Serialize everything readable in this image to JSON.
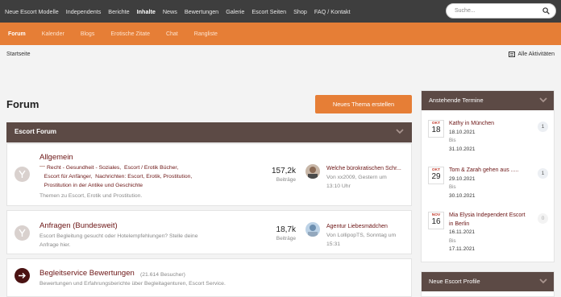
{
  "topnav": {
    "items": [
      "Neue Escort Modelle",
      "Independents",
      "Berichte",
      "Inhalte",
      "News",
      "Bewertungen",
      "Galerie",
      "Escort Seiten",
      "Shop",
      "FAQ / Kontakt"
    ],
    "active": "Inhalte",
    "search_placeholder": "Suche..."
  },
  "subnav": {
    "items": [
      "Forum",
      "Kalender",
      "Blogs",
      "Erotische Zitate",
      "Chat",
      "Rangliste"
    ],
    "active": "Forum"
  },
  "breadcrumb": "Startseite",
  "activity_label": "Alle Aktivitäten",
  "page_title": "Forum",
  "new_thread_label": "Neues Thema erstellen",
  "category": {
    "title": "Escort Forum"
  },
  "nodes": [
    {
      "title": "Allgemein",
      "subforums": [
        "Recht - Gesundheit - Soziales,",
        "Escort / Erotik Bücher,",
        "Escort für Anfänger,",
        "Nachrichten: Escort, Erotik, Prostitution,",
        "Prostitution in der Antike und Geschichte"
      ],
      "description": "Themen zu Escort, Erotik und Prostitution.",
      "count": "157,2k",
      "count_label": "Beiträge",
      "last_title": "Welche bürokratischen Schr...",
      "last_meta_1": "Von xx2009, Gestern um",
      "last_meta_2": "13:10 Uhr"
    },
    {
      "title": "Anfragen (Bundesweit)",
      "description_1": "Escort Begleitung gesucht oder Hotelempfehlungen? Stelle deine",
      "description_2": "Anfrage hier.",
      "count": "18,7k",
      "count_label": "Beiträge",
      "last_title": "Agentur Liebesmädchen",
      "last_meta_1": "Von LollipopTS, Sonntag um",
      "last_meta_2": "15:31"
    },
    {
      "title": "Begleitservice Bewertungen",
      "visitors": "(21.614 Besucher)",
      "description": "Bewertungen und Erfahrungsberichte über Begleitagenturen, Escort Service."
    }
  ],
  "sidebar": {
    "events_title": "Anstehende Termine",
    "events": [
      {
        "month": "OKT",
        "day": "18",
        "name": "Kathy in München",
        "start": "18.10.2021",
        "bis": "Bis",
        "end": "31.10.2021",
        "count": "1"
      },
      {
        "month": "OKT",
        "day": "29",
        "name": "Tom & Zarah gehen aus .....",
        "start": "29.10.2021",
        "bis": "Bis",
        "end": "30.10.2021",
        "count": "1"
      },
      {
        "month": "NOV",
        "day": "16",
        "name": "Mia Elysia Independent Escort",
        "name_2": "in Berlin",
        "start": "16.11.2021",
        "bis": "Bis",
        "end": "17.11.2021",
        "count": "0"
      }
    ],
    "profiles_title": "Neue Escort Profile"
  },
  "colors": {
    "topbar": "#3e3e3e",
    "accent": "#e67e36",
    "header": "#5c4a45",
    "link": "#6b1414"
  }
}
